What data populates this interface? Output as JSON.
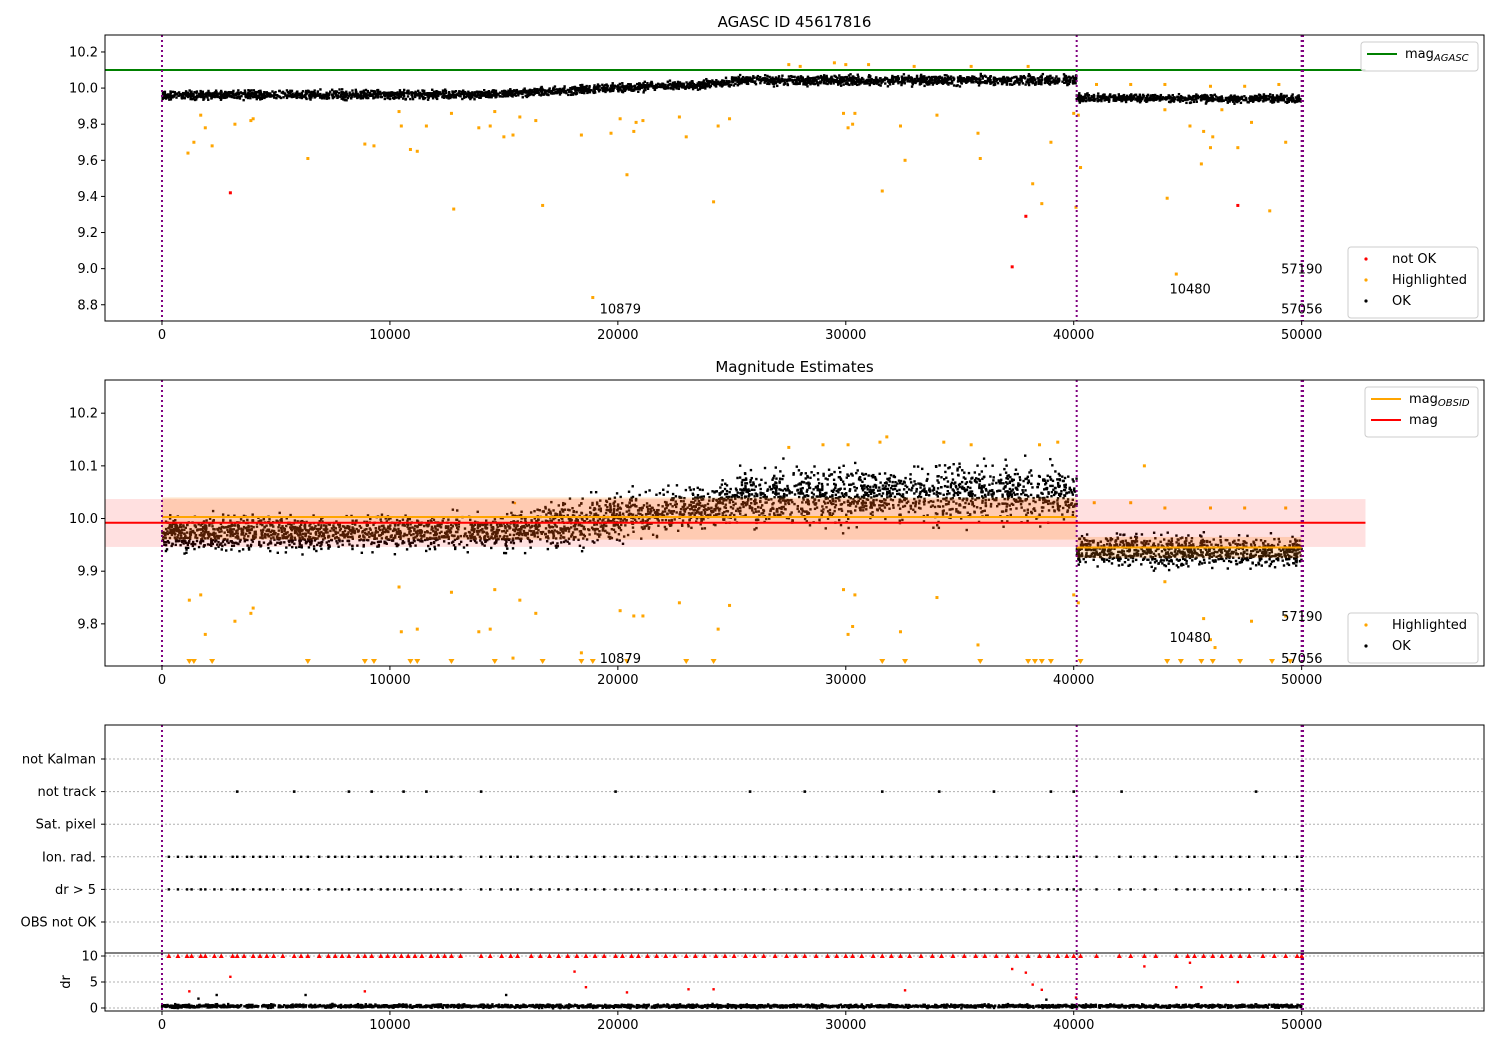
{
  "chart_data": [
    {
      "type": "scatter",
      "title": "AGASC ID 45617816",
      "xlim": [
        -2500,
        58000
      ],
      "ylim": [
        8.71,
        10.294
      ],
      "xticks": [
        0,
        10000,
        20000,
        30000,
        40000,
        50000
      ],
      "yticks": [
        8.8,
        9.0,
        9.2,
        9.4,
        9.6,
        9.8,
        10.0,
        10.2
      ],
      "ytick_labels": [
        "8.8",
        "9.0",
        "9.2",
        "9.4",
        "9.6",
        "9.8",
        "10.0",
        "10.2"
      ],
      "obs_boundaries": [
        0,
        40130,
        50000,
        50060
      ],
      "lines": [
        {
          "name": "mag",
          "sub": "AGASC",
          "value": 10.1,
          "x_range": [
            -2500,
            52800
          ],
          "color": "#008000"
        }
      ],
      "ok_trend": [
        [
          0,
          15000,
          9.96,
          9.965,
          0.035
        ],
        [
          15000,
          25000,
          9.97,
          10.03,
          0.035
        ],
        [
          25000,
          40130,
          10.04,
          10.045,
          0.04
        ],
        [
          40130,
          50000,
          9.945,
          9.94,
          0.03
        ]
      ],
      "highlighted": [
        [
          1140,
          9.64
        ],
        [
          1400,
          9.7
        ],
        [
          1700,
          9.85
        ],
        [
          1900,
          9.78
        ],
        [
          2200,
          9.68
        ],
        [
          3200,
          9.8
        ],
        [
          3900,
          9.82
        ],
        [
          4000,
          9.83
        ],
        [
          6400,
          9.61
        ],
        [
          8900,
          9.69
        ],
        [
          9300,
          9.68
        ],
        [
          10400,
          9.87
        ],
        [
          10500,
          9.79
        ],
        [
          10900,
          9.66
        ],
        [
          11200,
          9.65
        ],
        [
          11600,
          9.79
        ],
        [
          12700,
          9.86
        ],
        [
          12800,
          9.33
        ],
        [
          13900,
          9.78
        ],
        [
          14400,
          9.79
        ],
        [
          14600,
          9.87
        ],
        [
          15000,
          9.73
        ],
        [
          15400,
          9.74
        ],
        [
          15700,
          9.84
        ],
        [
          16400,
          9.82
        ],
        [
          16700,
          9.35
        ],
        [
          18400,
          9.74
        ],
        [
          18900,
          8.84
        ],
        [
          19700,
          9.75
        ],
        [
          20100,
          9.83
        ],
        [
          20400,
          9.52
        ],
        [
          20700,
          9.76
        ],
        [
          20800,
          9.81
        ],
        [
          21100,
          9.82
        ],
        [
          22700,
          9.84
        ],
        [
          23000,
          9.73
        ],
        [
          24200,
          9.37
        ],
        [
          24400,
          9.79
        ],
        [
          24900,
          9.83
        ],
        [
          29900,
          9.86
        ],
        [
          30100,
          9.78
        ],
        [
          30300,
          9.8
        ],
        [
          30400,
          9.86
        ],
        [
          31600,
          9.43
        ],
        [
          32400,
          9.79
        ],
        [
          32600,
          9.6
        ],
        [
          34000,
          9.85
        ],
        [
          35800,
          9.75
        ],
        [
          35900,
          9.61
        ],
        [
          38200,
          9.47
        ],
        [
          38600,
          9.36
        ],
        [
          39000,
          9.7
        ],
        [
          40000,
          9.86
        ],
        [
          40200,
          9.85
        ],
        [
          40300,
          9.56
        ],
        [
          40100,
          9.34
        ],
        [
          44100,
          9.39
        ],
        [
          44500,
          8.97
        ],
        [
          45100,
          9.79
        ],
        [
          45600,
          9.58
        ],
        [
          45700,
          9.76
        ],
        [
          46000,
          9.67
        ],
        [
          46100,
          9.73
        ],
        [
          47200,
          9.67
        ],
        [
          47800,
          9.81
        ],
        [
          48600,
          9.32
        ],
        [
          49300,
          9.7
        ],
        [
          44000,
          9.88
        ],
        [
          46500,
          9.88
        ],
        [
          27500,
          10.13
        ],
        [
          28000,
          10.12
        ],
        [
          29500,
          10.14
        ],
        [
          30000,
          10.13
        ],
        [
          31000,
          10.13
        ],
        [
          33000,
          10.12
        ],
        [
          35500,
          10.12
        ],
        [
          38000,
          10.12
        ],
        [
          41000,
          10.02
        ],
        [
          42500,
          10.02
        ],
        [
          44000,
          10.02
        ],
        [
          46000,
          10.01
        ],
        [
          47500,
          10.01
        ],
        [
          49000,
          10.02
        ]
      ],
      "not_ok": [
        [
          3000,
          9.42
        ],
        [
          37300,
          9.01
        ],
        [
          37900,
          9.29
        ],
        [
          47200,
          9.35
        ]
      ],
      "annotations": [
        {
          "text": "10879",
          "x": 19200,
          "y": 8.78
        },
        {
          "text": "10480",
          "x": 44200,
          "y": 8.89
        },
        {
          "text": "57190",
          "x": 49100,
          "y": 9.0
        },
        {
          "text": "57056",
          "x": 49100,
          "y": 8.78
        }
      ],
      "legend_top": {
        "label": "mag",
        "sub": "AGASC",
        "placement": "upper-right"
      },
      "legend_bottom": [
        {
          "label": "not OK",
          "color": "#ff0000"
        },
        {
          "label": "Highlighted",
          "color": "#ffa500"
        },
        {
          "label": "OK",
          "color": "#000000"
        }
      ]
    },
    {
      "type": "scatter",
      "title": "Magnitude Estimates",
      "xlim": [
        -2500,
        58000
      ],
      "ylim": [
        9.72,
        10.263
      ],
      "xticks": [
        0,
        10000,
        20000,
        30000,
        40000,
        50000
      ],
      "yticks": [
        9.8,
        9.9,
        10.0,
        10.1,
        10.2
      ],
      "ytick_labels": [
        "9.8",
        "9.9",
        "10.0",
        "10.1",
        "10.2"
      ],
      "obs_boundaries": [
        0,
        40130,
        50000,
        50060
      ],
      "mag": {
        "value": 9.992,
        "band": [
          9.946,
          10.037
        ],
        "x_range": [
          -2500,
          52800
        ],
        "color": "#ff0000"
      },
      "mag_obsid": [
        {
          "x_range": [
            0,
            40130
          ],
          "value": 10.003,
          "band": [
            9.96,
            10.04
          ]
        },
        {
          "x_range": [
            40130,
            50000
          ],
          "value": 9.945,
          "band": [
            9.925,
            9.965
          ]
        }
      ],
      "ok_trend": [
        [
          0,
          15000,
          9.97,
          9.975,
          0.045
        ],
        [
          15000,
          25000,
          9.975,
          10.03,
          0.06
        ],
        [
          25000,
          40130,
          10.04,
          10.05,
          0.075
        ],
        [
          40130,
          50000,
          9.94,
          9.935,
          0.04
        ]
      ],
      "highlighted": [
        [
          1200,
          9.845
        ],
        [
          1700,
          9.855
        ],
        [
          1900,
          9.78
        ],
        [
          3200,
          9.805
        ],
        [
          3900,
          9.82
        ],
        [
          4000,
          9.83
        ],
        [
          10400,
          9.87
        ],
        [
          10500,
          9.785
        ],
        [
          11200,
          9.79
        ],
        [
          12700,
          9.86
        ],
        [
          13900,
          9.785
        ],
        [
          14400,
          9.79
        ],
        [
          14600,
          9.865
        ],
        [
          15400,
          9.735
        ],
        [
          15700,
          9.845
        ],
        [
          16400,
          9.82
        ],
        [
          18400,
          9.745
        ],
        [
          20100,
          9.825
        ],
        [
          20700,
          9.815
        ],
        [
          21100,
          9.815
        ],
        [
          22700,
          9.84
        ],
        [
          24400,
          9.79
        ],
        [
          24900,
          9.835
        ],
        [
          29900,
          9.865
        ],
        [
          30100,
          9.78
        ],
        [
          30300,
          9.795
        ],
        [
          30400,
          9.855
        ],
        [
          32400,
          9.785
        ],
        [
          34000,
          9.85
        ],
        [
          35800,
          9.76
        ],
        [
          40000,
          9.855
        ],
        [
          40200,
          9.84
        ],
        [
          43100,
          10.1
        ],
        [
          44000,
          9.88
        ],
        [
          45700,
          9.81
        ],
        [
          46000,
          9.77
        ],
        [
          46200,
          9.755
        ],
        [
          47800,
          9.805
        ],
        [
          49300,
          9.815
        ],
        [
          27500,
          10.135
        ],
        [
          29000,
          10.14
        ],
        [
          30100,
          10.14
        ],
        [
          31500,
          10.145
        ],
        [
          31800,
          10.155
        ],
        [
          34300,
          10.145
        ],
        [
          35500,
          10.14
        ],
        [
          38500,
          10.14
        ],
        [
          39300,
          10.145
        ],
        [
          40900,
          10.03
        ],
        [
          42500,
          10.03
        ],
        [
          44000,
          10.02
        ],
        [
          46000,
          10.02
        ],
        [
          47500,
          10.02
        ],
        [
          49300,
          10.02
        ]
      ],
      "highlighted_below_range": [
        1200,
        1400,
        2200,
        6400,
        8900,
        9300,
        10900,
        11200,
        12700,
        14600,
        16700,
        18400,
        18900,
        20400,
        23000,
        24200,
        31600,
        32600,
        35900,
        38000,
        38300,
        38600,
        39000,
        40300,
        44100,
        44700,
        45600,
        46100,
        47300,
        48700,
        49500
      ],
      "annotations": [
        {
          "text": "10879",
          "x": 19200,
          "y": 9.735
        },
        {
          "text": "10480",
          "x": 44200,
          "y": 9.775
        },
        {
          "text": "57190",
          "x": 49100,
          "y": 9.815
        },
        {
          "text": "57056",
          "x": 49100,
          "y": 9.735
        }
      ],
      "legend_top": [
        {
          "label": "mag",
          "sub": "OBSID",
          "color": "#ffa500"
        },
        {
          "label": "mag",
          "sub": "",
          "color": "#ff0000"
        }
      ],
      "legend_bottom": [
        {
          "label": "Highlighted",
          "color": "#ffa500"
        },
        {
          "label": "OK",
          "color": "#000000"
        }
      ]
    },
    {
      "type": "scatter",
      "flag_rows": [
        "not Kalman",
        "not track",
        "Sat. pixel",
        "Ion. rad.",
        "dr > 5",
        "OBS not OK"
      ],
      "not_track": [
        3300,
        5800,
        8200,
        9200,
        10600,
        11600,
        14000,
        19900,
        25800,
        28200,
        31600,
        34100,
        36500,
        39000,
        40000,
        42100,
        48000
      ],
      "flagged_frames": [
        300,
        700,
        1100,
        1300,
        1700,
        1900,
        2300,
        2600,
        3100,
        3300,
        3600,
        4000,
        4300,
        4600,
        4900,
        5300,
        5800,
        6100,
        6400,
        6900,
        7300,
        7600,
        7900,
        8200,
        8600,
        8900,
        9200,
        9600,
        9900,
        10200,
        10500,
        10800,
        11100,
        11400,
        11800,
        12100,
        12400,
        12700,
        13100,
        14000,
        14400,
        14900,
        15300,
        15600,
        16200,
        16600,
        17000,
        17400,
        17800,
        18200,
        18600,
        19000,
        19400,
        19900,
        20200,
        20600,
        20900,
        21300,
        21700,
        22100,
        22500,
        23000,
        23400,
        23800,
        24300,
        24700,
        25100,
        25600,
        26000,
        26400,
        26900,
        27400,
        27800,
        28200,
        28700,
        29200,
        29600,
        30000,
        30300,
        30700,
        31200,
        31600,
        32000,
        32400,
        32800,
        33300,
        33800,
        34200,
        34700,
        35200,
        35700,
        36100,
        36600,
        37100,
        37500,
        38000,
        38500,
        38900,
        39300,
        39700,
        40000,
        40300,
        41000,
        42000,
        42500,
        43100,
        43600,
        44500,
        45000,
        45300,
        45700,
        46100,
        46500,
        46900,
        47300,
        47700,
        48300,
        48800,
        49300,
        49800,
        50000
      ],
      "dr_ticks": [
        0,
        5,
        10
      ],
      "dr_ylabel": "dr",
      "dr_ylim": [
        -0.58,
        10.58
      ],
      "dr_ok_trend": [
        [
          0,
          50000,
          0.35,
          0.35,
          0.45
        ]
      ],
      "dr_not_ok": [
        [
          1200,
          3.2
        ],
        [
          3000,
          6
        ],
        [
          8900,
          3.2
        ],
        [
          18100,
          7
        ],
        [
          18600,
          4
        ],
        [
          20400,
          3
        ],
        [
          23100,
          3.6
        ],
        [
          24200,
          3.6
        ],
        [
          32600,
          3.4
        ],
        [
          37300,
          7.5
        ],
        [
          37900,
          6.8
        ],
        [
          38200,
          4.5
        ],
        [
          38600,
          3.5
        ],
        [
          40100,
          2
        ],
        [
          43100,
          8
        ],
        [
          44500,
          4
        ],
        [
          45100,
          8.7
        ],
        [
          45600,
          4
        ],
        [
          47200,
          5
        ]
      ],
      "dr_ok_outliers": [
        [
          1600,
          1.8
        ],
        [
          2400,
          2.5
        ],
        [
          6300,
          2.5
        ],
        [
          15100,
          2.5
        ],
        [
          38800,
          1.6
        ]
      ],
      "xticks": [
        0,
        10000,
        20000,
        30000,
        40000,
        50000
      ]
    }
  ]
}
